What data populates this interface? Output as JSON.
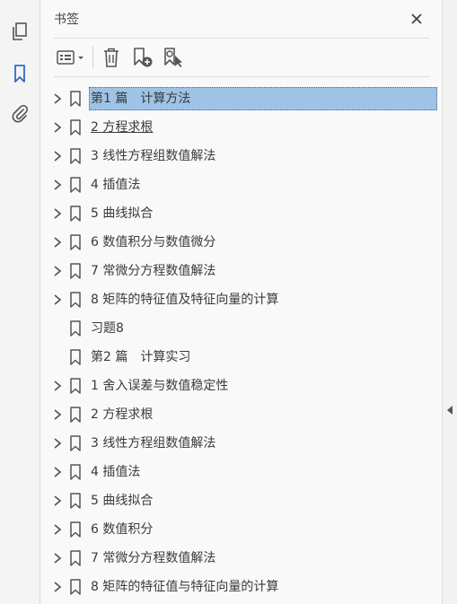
{
  "panel": {
    "title": "书签",
    "close_symbol": "✕"
  },
  "left_toolbar": {
    "items": [
      {
        "icon": "pages-icon"
      },
      {
        "icon": "bookmark-icon",
        "active": true
      },
      {
        "icon": "attachment-icon"
      }
    ]
  },
  "toolbar": {
    "buttons": [
      {
        "icon": "options-menu-icon"
      },
      {
        "icon": "delete-icon"
      },
      {
        "icon": "new-bookmark-icon"
      },
      {
        "icon": "find-bookmark-icon"
      }
    ]
  },
  "colors": {
    "selected_bg": "#9ec3e6",
    "active_icon": "#2a6fc9"
  },
  "bookmarks": [
    {
      "label": "第1 篇　计算方法",
      "expandable": true,
      "selected": true
    },
    {
      "label": "2 方程求根",
      "expandable": true,
      "underlined": true
    },
    {
      "label": "3 线性方程组数值解法",
      "expandable": true
    },
    {
      "label": "4 插值法",
      "expandable": true
    },
    {
      "label": "5 曲线拟合",
      "expandable": true
    },
    {
      "label": "6 数值积分与数值微分",
      "expandable": true
    },
    {
      "label": "7 常微分方程数值解法",
      "expandable": true
    },
    {
      "label": "8 矩阵的特征值及特征向量的计算",
      "expandable": true
    },
    {
      "label": "习题8",
      "expandable": false
    },
    {
      "label": "第2 篇　计算实习",
      "expandable": false
    },
    {
      "label": "1 舍入误差与数值稳定性",
      "expandable": true
    },
    {
      "label": "2 方程求根",
      "expandable": true
    },
    {
      "label": "3 线性方程组数值解法",
      "expandable": true
    },
    {
      "label": "4 插值法",
      "expandable": true
    },
    {
      "label": "5 曲线拟合",
      "expandable": true
    },
    {
      "label": "6 数值积分",
      "expandable": true
    },
    {
      "label": "7 常微分方程数值解法",
      "expandable": true
    },
    {
      "label": "8 矩阵的特征值与特征向量的计算",
      "expandable": true
    }
  ]
}
